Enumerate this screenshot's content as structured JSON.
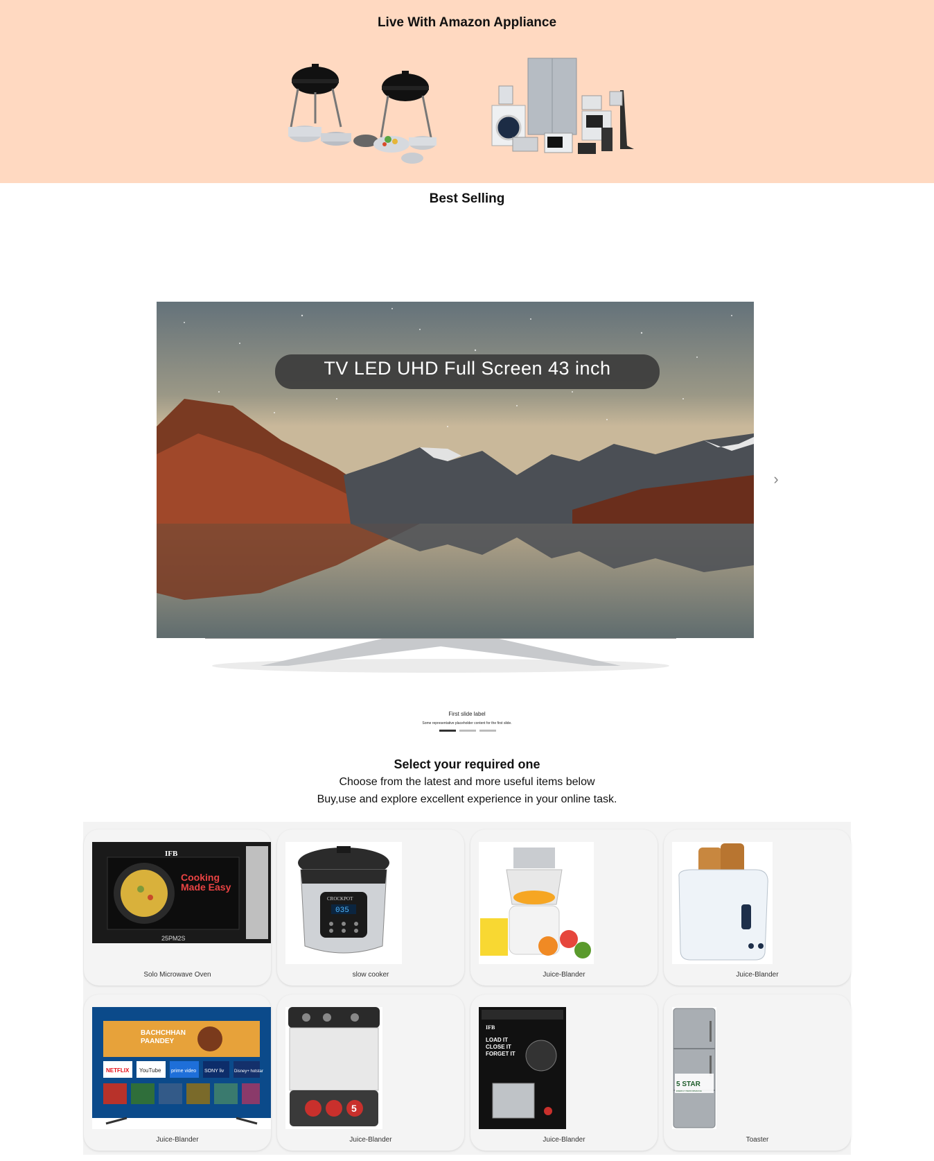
{
  "hero": {
    "title": "Live With Amazon Appliance"
  },
  "best_selling": {
    "title": "Best Selling"
  },
  "carousel": {
    "caption": "TV LED UHD Full Screen 43 inch",
    "slide_label": "First slide label",
    "slide_text": "Some representative placeholder content for the first slide.",
    "next_icon": "chevron-right-icon",
    "next_glyph": "›",
    "slides_count": 3,
    "active_slide": 1
  },
  "select": {
    "title": "Select your required one",
    "line1": "Choose from the latest and more useful items below",
    "line2": "Buy,use and explore excellent experience in your online task."
  },
  "products": [
    {
      "label": "Solo Microwave Oven",
      "kind": "microwave"
    },
    {
      "label": "slow cooker",
      "kind": "cooker"
    },
    {
      "label": "Juice-Blander",
      "kind": "juicer"
    },
    {
      "label": "Juice-Blander",
      "kind": "toaster"
    },
    {
      "label": "Juice-Blander",
      "kind": "tv"
    },
    {
      "label": "Juice-Blander",
      "kind": "washer"
    },
    {
      "label": "Juice-Blander",
      "kind": "dishwasher"
    },
    {
      "label": "Toaster",
      "kind": "fridge"
    }
  ],
  "product_art": {
    "microwave_brand": "IFB",
    "microwave_line1": "Cooking",
    "microwave_line2": "Made Easy",
    "microwave_model": "25PM2S",
    "cooker_brand": "CROCKPOT",
    "cooker_display": "035",
    "tv_banner_line1": "BACHCHHAN",
    "tv_banner_line2": "PAANDEY",
    "tv_app1": "NETFLIX",
    "tv_app2": "YouTube",
    "tv_app3": "prime video",
    "tv_app4": "SONY liv",
    "tv_app5": "Disney+ hotstar",
    "washer_badge": "5",
    "dishwasher_brand": "IFB",
    "dishwasher_line1": "LOAD IT",
    "dishwasher_line2": "CLOSE IT",
    "dishwasher_line3": "FORGET IT",
    "fridge_badge_line1": "5 STAR",
    "fridge_badge_line2": "ENERGY PERFORMANCE"
  },
  "colors": {
    "hero_bg": "#ffd9c1",
    "caption_bg": "#3c3c3c",
    "card_bg": "#f4f4f4"
  }
}
